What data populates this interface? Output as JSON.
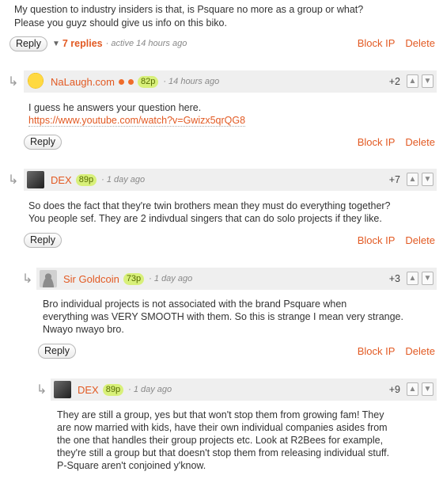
{
  "top": {
    "line1": "My question to industry insiders is that, is Psquare no more as a group or what?",
    "line2": "Please you guyz should give us info on this biko.",
    "reply_label": "Reply",
    "replies_label": "7 replies",
    "active_note": "· active 14 hours ago",
    "block_label": "Block IP",
    "delete_label": "Delete"
  },
  "comments": [
    {
      "user": "NaLaugh.com",
      "points": "82p",
      "time": "· 14 hours ago",
      "score": "+2",
      "text": "I guess he answers your question here.",
      "link": "https://www.youtube.com/watch?v=Gwizx5qrQG8",
      "reply_label": "Reply",
      "block_label": "Block IP",
      "delete_label": "Delete"
    },
    {
      "user": "DEX",
      "points": "89p",
      "time": "· 1 day ago",
      "score": "+7",
      "line1": "So does the fact that they're twin brothers mean they must do everything together?",
      "line2": "You people sef. They are 2 indivdual singers that can do solo projects if they like.",
      "reply_label": "Reply",
      "block_label": "Block IP",
      "delete_label": "Delete"
    },
    {
      "user": "Sir Goldcoin",
      "points": "73p",
      "time": "· 1 day ago",
      "score": "+3",
      "line1": "Bro individual projects is not associated with the brand Psquare when",
      "line2": "everything was VERY SMOOTH with them. So this is strange I mean very strange.",
      "line3": "Nwayo nwayo bro.",
      "reply_label": "Reply",
      "block_label": "Block IP",
      "delete_label": "Delete"
    },
    {
      "user": "DEX",
      "points": "89p",
      "time": "· 1 day ago",
      "score": "+9",
      "line1": "They are still a group, yes but that won't stop them from growing fam! They",
      "line2": "are now married with kids, have their own individual companies asides from",
      "line3": "the one that handles their group projects etc. Look at R2Bees for example,",
      "line4": "they're still a group but that doesn't stop them from releasing individual stuff.",
      "line5": "P-Square aren't conjoined y'know."
    }
  ],
  "icons": {
    "upvote": "thumbs-up-icon",
    "downvote": "thumbs-down-icon",
    "indent": "reply-arrow-icon",
    "collapse": "triangle-down-icon"
  }
}
